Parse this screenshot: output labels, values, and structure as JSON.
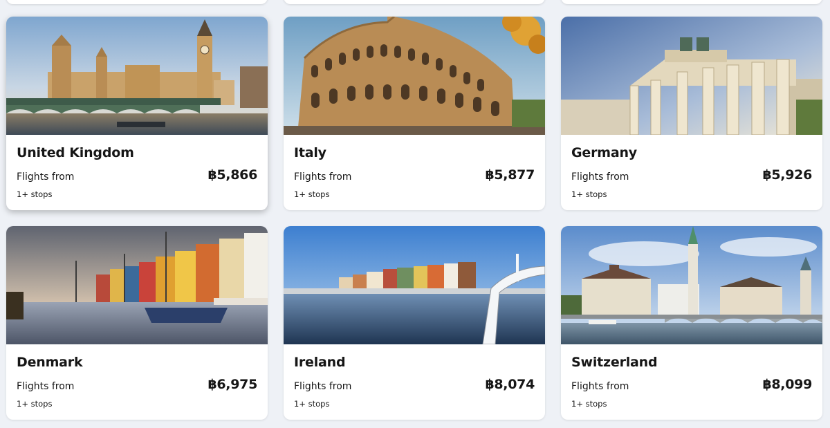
{
  "cards": [
    {
      "country": "United Kingdom",
      "flights_label": "Flights from",
      "price": "฿5,866",
      "stops": "1+ stops"
    },
    {
      "country": "Italy",
      "flights_label": "Flights from",
      "price": "฿5,877",
      "stops": "1+ stops"
    },
    {
      "country": "Germany",
      "flights_label": "Flights from",
      "price": "฿5,926",
      "stops": "1+ stops"
    },
    {
      "country": "Denmark",
      "flights_label": "Flights from",
      "price": "฿6,975",
      "stops": "1+ stops"
    },
    {
      "country": "Ireland",
      "flights_label": "Flights from",
      "price": "฿8,074",
      "stops": "1+ stops"
    },
    {
      "country": "Switzerland",
      "flights_label": "Flights from",
      "price": "฿8,099",
      "stops": "1+ stops"
    }
  ]
}
